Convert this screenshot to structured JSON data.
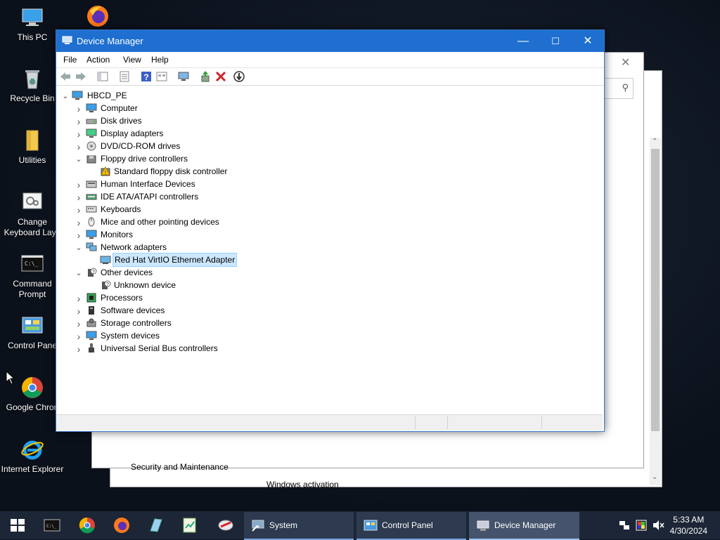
{
  "desktop": {
    "icons": [
      {
        "label": "This PC"
      },
      {
        "label": "Recycle Bin"
      },
      {
        "label": "Utilities"
      },
      {
        "label_line1": "Change",
        "label_line2": "Keyboard Layo"
      },
      {
        "label_line1": "Command",
        "label_line2": "Prompt"
      },
      {
        "label": "Control Pane"
      },
      {
        "label": "Google Chron"
      },
      {
        "label": "Internet Explorer"
      }
    ]
  },
  "background_window": {
    "text1": "Security and Maintenance",
    "text2": "Windows activation"
  },
  "window": {
    "title": "Device Manager",
    "menu": [
      "File",
      "Action",
      "View",
      "Help"
    ],
    "tree": {
      "root": "HBCD_PE",
      "categories": [
        {
          "label": "Computer",
          "expanded": false
        },
        {
          "label": "Disk drives",
          "expanded": false
        },
        {
          "label": "Display adapters",
          "expanded": false
        },
        {
          "label": "DVD/CD-ROM drives",
          "expanded": false
        },
        {
          "label": "Floppy drive controllers",
          "expanded": true,
          "child": "Standard floppy disk controller"
        },
        {
          "label": "Human Interface Devices",
          "expanded": false
        },
        {
          "label": "IDE ATA/ATAPI controllers",
          "expanded": false
        },
        {
          "label": "Keyboards",
          "expanded": false
        },
        {
          "label": "Mice and other pointing devices",
          "expanded": false
        },
        {
          "label": "Monitors",
          "expanded": false
        },
        {
          "label": "Network adapters",
          "expanded": true,
          "child": "Red Hat VirtIO Ethernet Adapter"
        },
        {
          "label": "Other devices",
          "expanded": true,
          "child": "Unknown device"
        },
        {
          "label": "Processors",
          "expanded": false
        },
        {
          "label": "Software devices",
          "expanded": false
        },
        {
          "label": "Storage controllers",
          "expanded": false
        },
        {
          "label": "System devices",
          "expanded": false
        },
        {
          "label": "Universal Serial Bus controllers",
          "expanded": false
        }
      ]
    }
  },
  "taskbar": {
    "tasks": [
      {
        "label": "System"
      },
      {
        "label": "Control Panel"
      },
      {
        "label": "Device Manager"
      }
    ],
    "time": "5:33 AM",
    "date": "4/30/2024"
  },
  "colors": {
    "title_bar": "#1e6fd0",
    "selection": "#cce8ff",
    "taskbar": "#1c2636"
  }
}
